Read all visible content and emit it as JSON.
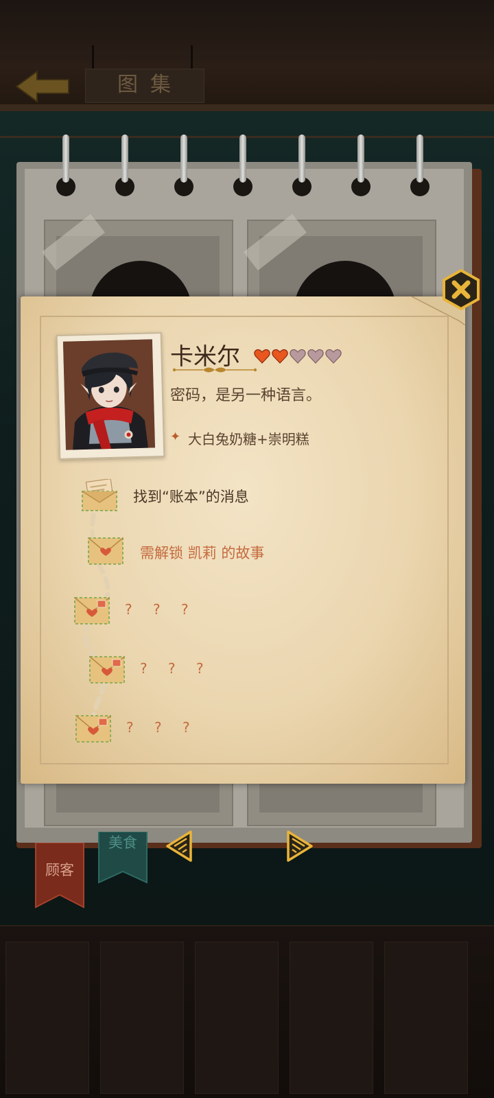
{
  "header": {
    "title": "图集"
  },
  "character": {
    "name": "卡米尔",
    "affinity": {
      "filled": 2,
      "total": 5
    },
    "quote": "密码，是另一种语言。",
    "favorite_food": "大白兔奶糖+崇明糕"
  },
  "stories": [
    {
      "text": "找到“账本”的消息",
      "state": "unlocked"
    },
    {
      "text": "需解锁 凯莉 的故事",
      "state": "requires"
    },
    {
      "text": "? ? ?",
      "state": "locked"
    },
    {
      "text": "? ? ?",
      "state": "locked"
    },
    {
      "text": "? ? ?",
      "state": "locked"
    }
  ],
  "tabs": [
    {
      "label": "顾客",
      "color": "#7a2b1c",
      "active": true
    },
    {
      "label": "美食",
      "color": "#1f4a45",
      "active": false
    }
  ],
  "colors": {
    "parchment": "#ead5ae",
    "heart_filled": "#e8571e",
    "heart_empty": "#b89a9e",
    "accent_text": "#c46a3e",
    "close_button": "#e8b43a"
  },
  "icons": {
    "back": "left-arrow-icon",
    "close": "close-x-icon",
    "prev": "triangle-left-icon",
    "next": "triangle-right-icon",
    "letter": "envelope-icon",
    "favorite": "diamond-star-icon"
  }
}
